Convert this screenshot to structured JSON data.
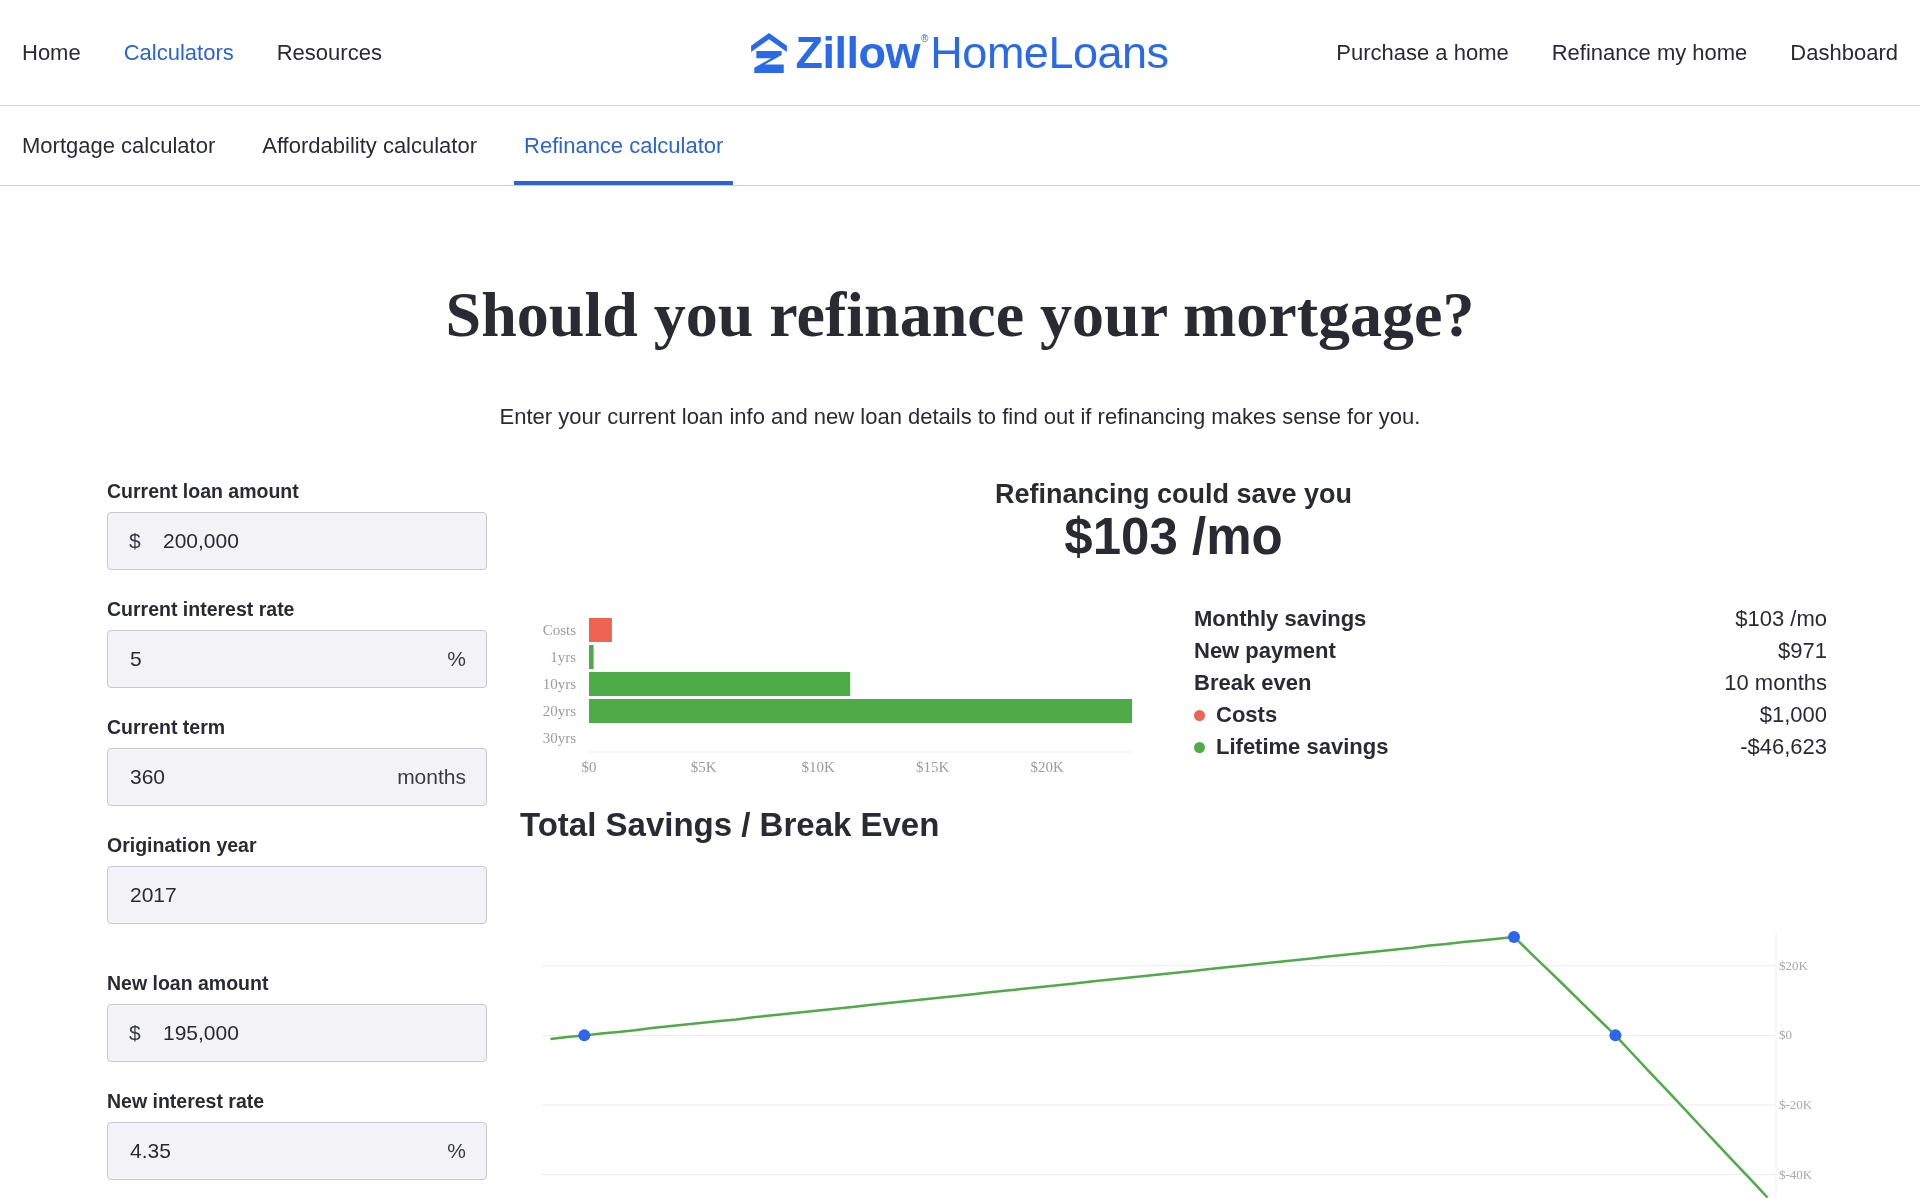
{
  "header": {
    "nav_left": [
      {
        "label": "Home",
        "selected": false
      },
      {
        "label": "Calculators",
        "selected": true
      },
      {
        "label": "Resources",
        "selected": false
      }
    ],
    "logo": {
      "brand": "Zillow",
      "registered": "®",
      "product": "HomeLoans"
    },
    "nav_right": [
      {
        "label": "Purchase a home"
      },
      {
        "label": "Refinance my home"
      },
      {
        "label": "Dashboard"
      }
    ]
  },
  "tabs": [
    {
      "label": "Mortgage calculator",
      "selected": false
    },
    {
      "label": "Affordability calculator",
      "selected": false
    },
    {
      "label": "Refinance calculator",
      "selected": true
    }
  ],
  "heading": "Should you refinance your mortgage?",
  "intro": "Enter your current loan info and new loan details to find out if refinancing makes sense for you.",
  "form": {
    "current_loan": [
      {
        "label": "Current loan amount",
        "prefix": "$",
        "value": "200,000"
      },
      {
        "label": "Current interest rate",
        "value": "5",
        "suffix": "%"
      },
      {
        "label": "Current term",
        "value": "360",
        "suffix": "months"
      },
      {
        "label": "Origination year",
        "value": "2017"
      }
    ],
    "new_loan": [
      {
        "label": "New loan amount",
        "prefix": "$",
        "value": "195,000"
      },
      {
        "label": "New interest rate",
        "value": "4.35",
        "suffix": "%"
      }
    ]
  },
  "results": {
    "headline": "Refinancing could save you",
    "amount": "$103 /mo",
    "breakdown_chart": {
      "chart_data": {
        "type": "bar",
        "orientation": "horizontal",
        "stacked": true,
        "categories": [
          "Costs",
          "1yrs",
          "10yrs",
          "20yrs",
          "30yrs"
        ],
        "series": [
          {
            "color": "#ee6352",
            "values": [
              1000,
              0,
              0,
              0,
              0
            ]
          },
          {
            "color": "#4fab48",
            "values": [
              0,
              200,
              11400,
              23700,
              0
            ]
          }
        ],
        "xlim": [
          0,
          23700
        ],
        "xticks": [
          {
            "value": 0,
            "label": "$0"
          },
          {
            "value": 5000,
            "label": "$5K"
          },
          {
            "value": 10000,
            "label": "$10K"
          },
          {
            "value": 15000,
            "label": "$15K"
          },
          {
            "value": 20000,
            "label": "$20K"
          }
        ]
      }
    },
    "summary": [
      {
        "label": "Monthly savings",
        "value": "$103 /mo"
      },
      {
        "label": "New payment",
        "value": "$971"
      },
      {
        "label": "Break even",
        "value": "10 months"
      },
      {
        "label": "Costs",
        "value": "$1,000",
        "color": "#ee6352"
      },
      {
        "label": "Lifetime savings",
        "value": "-$46,623",
        "color": "#4fab48"
      }
    ],
    "savings_chart": {
      "chart_data": {
        "type": "line",
        "title": "Total Savings / Break Even",
        "categories": [
          null,
          null,
          null,
          null,
          null,
          null,
          null,
          null,
          null,
          null,
          null,
          null,
          null,
          null,
          null,
          null,
          null,
          null,
          null,
          null,
          null,
          null,
          null,
          null,
          null,
          null,
          null,
          null,
          null,
          null,
          null,
          null,
          null,
          null,
          null,
          null,
          null,
          null,
          null,
          null,
          null,
          null,
          null,
          null,
          null,
          null,
          null,
          null,
          null,
          null,
          null,
          null,
          null,
          null,
          null,
          null,
          null,
          null,
          null,
          null,
          null,
          null,
          null,
          null,
          null,
          null,
          null,
          null,
          null,
          null,
          null,
          null,
          null
        ],
        "series": [
          {
            "color": "#4fab48",
            "values": [
              -1000,
              -500,
              0,
              500,
              1000,
              1500,
              2100,
              2600,
              3100,
              3600,
              4100,
              4600,
              5200,
              5700,
              6200,
              6700,
              7200,
              7700,
              8200,
              8800,
              9300,
              9800,
              10300,
              10800,
              11300,
              11800,
              12400,
              12900,
              13400,
              13900,
              14400,
              14900,
              15500,
              16000,
              16500,
              17000,
              17500,
              18000,
              18500,
              19100,
              19600,
              20100,
              20600,
              21100,
              21600,
              22100,
              22700,
              23200,
              23700,
              24200,
              24700,
              25200,
              25800,
              26300,
              26800,
              27300,
              27800,
              28300,
              23600,
              18900,
              14200,
              9400,
              4700,
              0,
              -5200,
              -10400,
              -15500,
              -20700,
              -25900,
              -31100,
              -36300,
              -41400,
              -46600
            ]
          }
        ],
        "grid": true,
        "ylim": [
          -46600,
          30000
        ],
        "yticks": [
          {
            "value": 20000,
            "label": "$20K"
          },
          {
            "value": 0,
            "label": "$0"
          },
          {
            "value": -20000,
            "label": "$-20K"
          },
          {
            "value": -40000,
            "label": "$-40K"
          }
        ]
      }
    }
  }
}
